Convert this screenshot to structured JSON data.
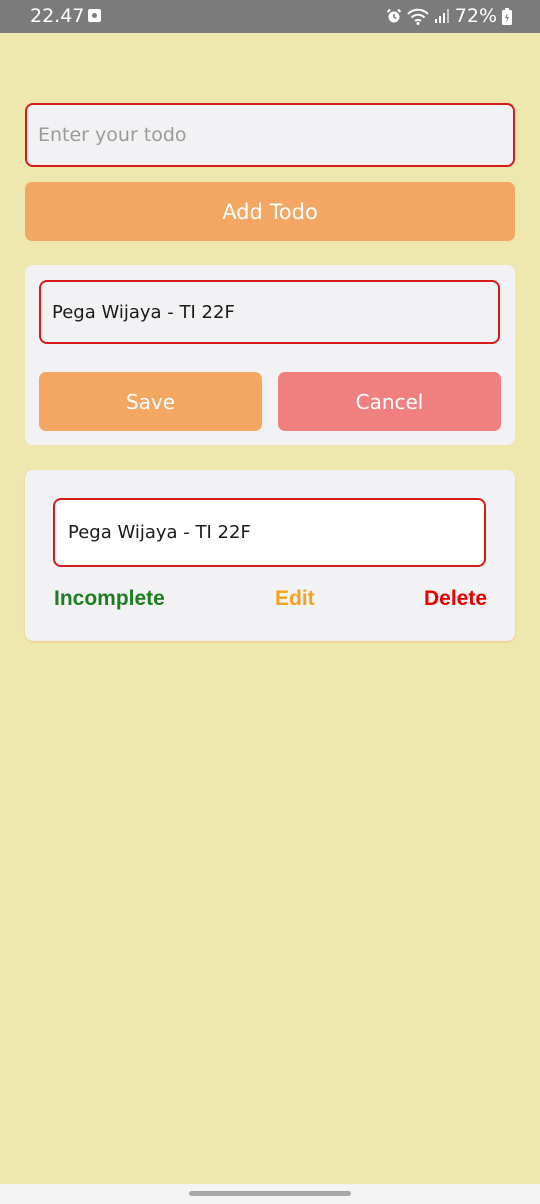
{
  "status_bar": {
    "time": "22.47",
    "battery_percent": "72%",
    "icons": [
      "notification-icon",
      "alarm-icon",
      "wifi-icon",
      "signal-icon",
      "battery-icon"
    ]
  },
  "form": {
    "placeholder": "Enter your todo",
    "add_label": "Add Todo"
  },
  "edit_panel": {
    "value": "Pega Wijaya - TI 22F",
    "save_label": "Save",
    "cancel_label": "Cancel"
  },
  "todos": [
    {
      "text": "Pega Wijaya - TI 22F",
      "status_label": "Incomplete",
      "edit_label": "Edit",
      "delete_label": "Delete"
    }
  ],
  "colors": {
    "background": "#eee8ae",
    "primary_button": "#f3a763",
    "cancel_button": "#f08080",
    "input_border": "#d61b1b",
    "incomplete": "#1f7d1f",
    "edit": "#f3a21d",
    "delete": "#e50000"
  }
}
